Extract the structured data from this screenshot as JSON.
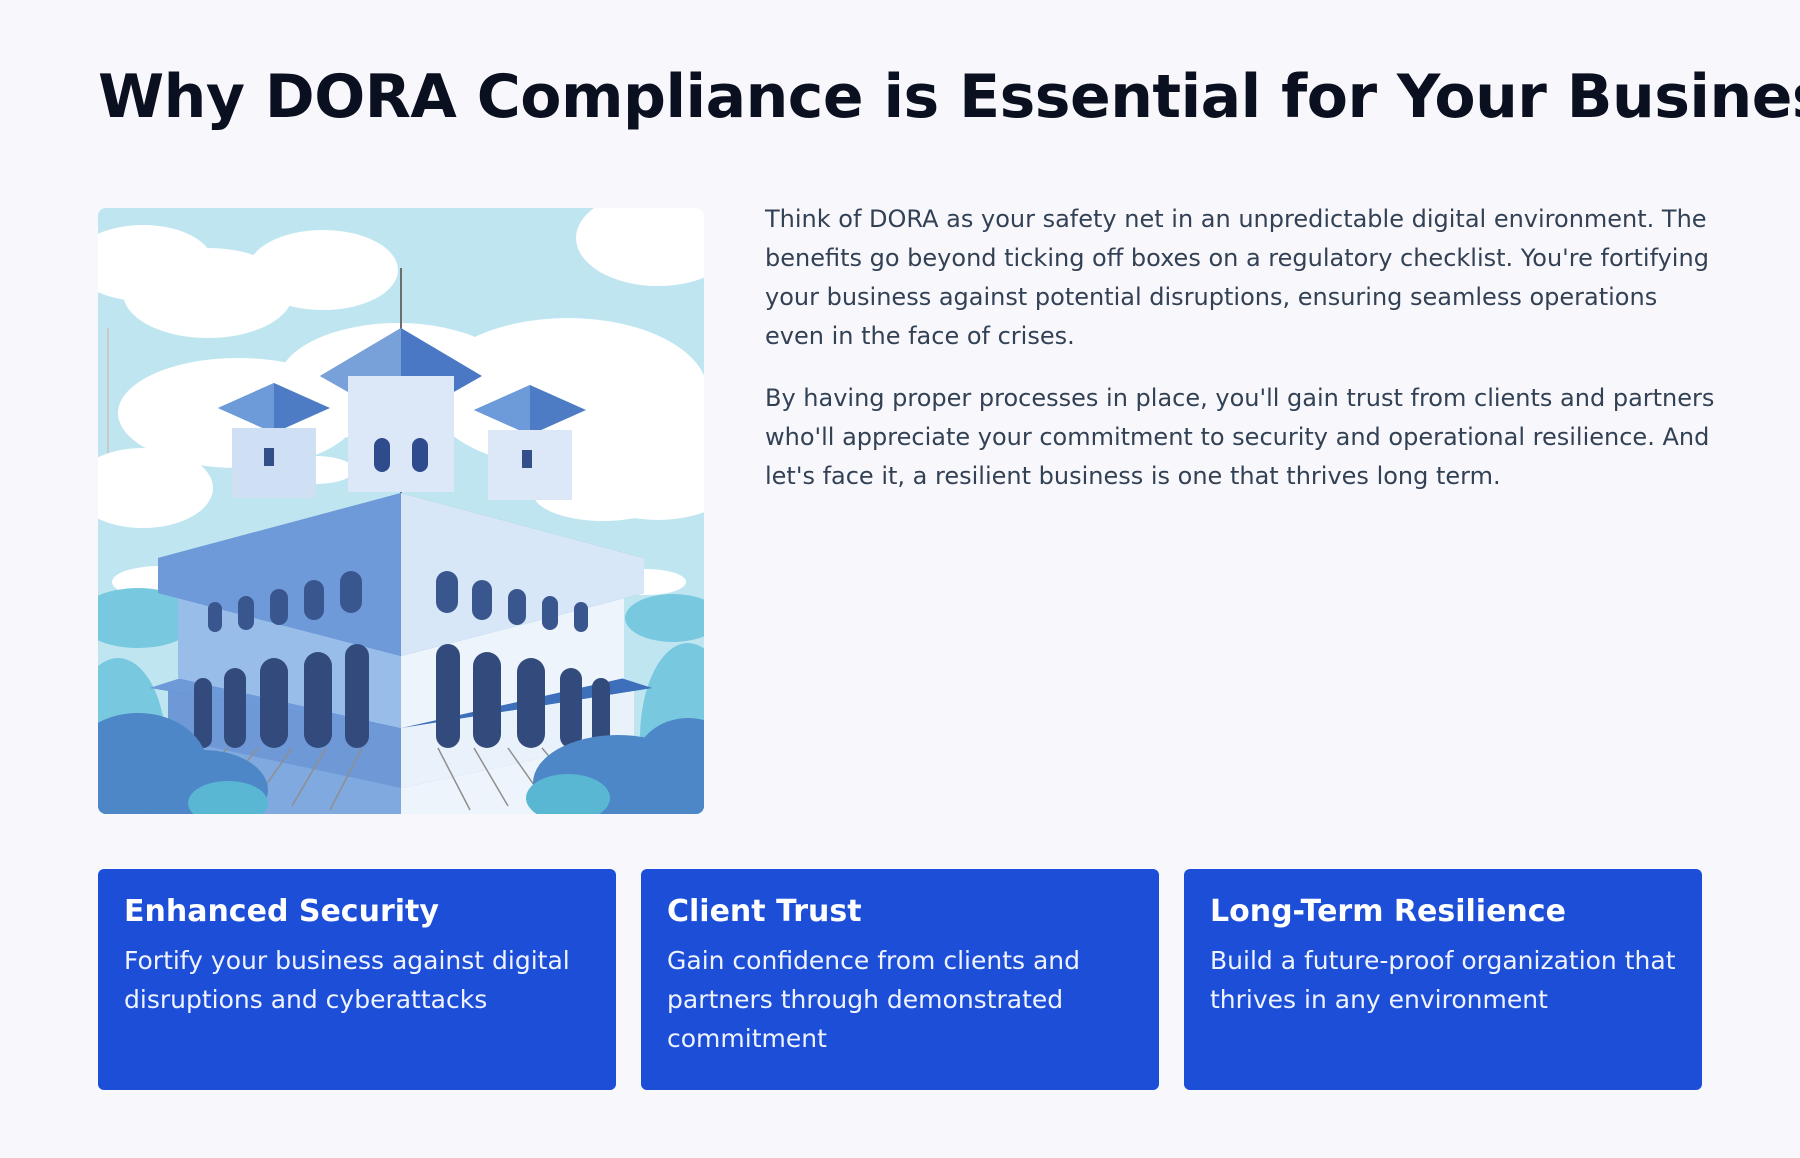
{
  "page": {
    "title": "Why DORA Compliance is Essential for Your Business"
  },
  "intro": {
    "paragraphs": [
      "Think of DORA as your safety net in an unpredictable digital environment. The benefits go beyond ticking off boxes on a regulatory checklist. You're fortifying your business against potential disruptions, ensuring seamless operations even in the face of crises.",
      "By having proper processes in place, you'll gain trust from clients and partners who'll appreciate your commitment to security and operational resilience. And let's face it, a resilient business is one that thrives long term."
    ]
  },
  "illustration": {
    "icon": "fortress-castle-illustration"
  },
  "cards": [
    {
      "title": "Enhanced Security",
      "text": "Fortify your business against digital disruptions and cyberattacks"
    },
    {
      "title": "Client Trust",
      "text": "Gain confidence from clients and partners through demonstrated commitment"
    },
    {
      "title": "Long-Term Resilience",
      "text": "Build a future-proof organization that thrives in any environment"
    }
  ],
  "colors": {
    "background": "#f8f8fc",
    "heading": "#0b1020",
    "body_text": "#334155",
    "card_background": "#1d4ed8",
    "card_text": "#ffffff"
  }
}
